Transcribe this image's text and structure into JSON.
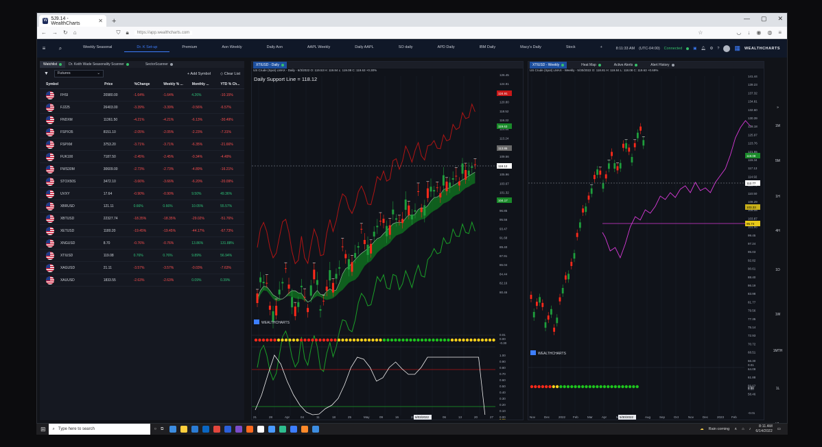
{
  "browser": {
    "tab_title": "5J9.14 - WealthCharts",
    "new_tab": "+",
    "url": "https://app.wealthcharts.com",
    "win_min": "—",
    "win_max": "▢",
    "win_close": "✕"
  },
  "app_tabs": [
    "Weekly Seasonal",
    "Dr. K Set-up",
    "Premium",
    "Aon Weekly",
    "Daily Aon",
    "AAPL Weekly",
    "Daily AAPL",
    "SO daily",
    "APD Daily",
    "IBM Daily",
    "Macy's Daily",
    "Stock"
  ],
  "header": {
    "add": "+",
    "time": "8:11:33 AM",
    "tz": "(UTC-04:00)",
    "status": "Connected",
    "logo": "WEALTHCHARTS"
  },
  "left": {
    "tabs": [
      "Watchlist",
      "Dr. Keith Wade Seasonality Scanner",
      "SectorScanner"
    ],
    "list_select": "Futures",
    "add_symbol": "Add Symbol",
    "clear_list": "Clear List",
    "columns": [
      "Symbol",
      "Price",
      "%Change",
      "Weekly % ...",
      "Monthly ...",
      "YTD % Ch..."
    ],
    "rows": [
      [
        "FHSI",
        "20980.00",
        "-1.64%",
        "-1.64%",
        "4.26%",
        "-10.15%"
      ],
      [
        "FJ225",
        "26403.00",
        "-3.39%",
        "-3.39%",
        "-0.56%",
        "-6.57%"
      ],
      [
        "FNDXM",
        "11361.50",
        "-4.21%",
        "-4.21%",
        "-6.13%",
        "-30.49%"
      ],
      [
        "FSPX35",
        "8151.10",
        "-2.05%",
        "-2.05%",
        "-2.23%",
        "-7.31%"
      ],
      [
        "FSPXM",
        "3753.20",
        "-3.71%",
        "-3.71%",
        "-6.35%",
        "-21.66%"
      ],
      [
        "FUK100",
        "7187.50",
        "-2.45%",
        "-2.45%",
        "-0.34%",
        "-4.49%"
      ],
      [
        "FWS30M",
        "30609.00",
        "-2.73%",
        "-2.73%",
        "-4.89%",
        "-16.21%"
      ],
      [
        "STOX50S",
        "3472.10",
        "-3.66%",
        "-3.66%",
        "-6.20%",
        "-20.09%"
      ],
      [
        "UVXY",
        "17.64",
        "-0.90%",
        "-0.90%",
        "9.50%",
        "49.36%"
      ],
      [
        "XBRUSD",
        "121.11",
        "0.66%",
        "0.66%",
        "10.05%",
        "55.57%"
      ],
      [
        "XBTUSD",
        "22327.74",
        "-18.35%",
        "-18.35%",
        "-29.02%",
        "-51.76%"
      ],
      [
        "XETUSD",
        "1180.20",
        "-19.45%",
        "-19.45%",
        "-44.17%",
        "-67.73%"
      ],
      [
        "XNGUSD",
        "8.70",
        "-0.76%",
        "-0.76%",
        "13.86%",
        "131.88%"
      ],
      [
        "XTIUSD",
        "119.08",
        "0.76%",
        "0.76%",
        "9.89%",
        "56.94%"
      ],
      [
        "XAGUSD",
        "21.11",
        "-3.57%",
        "-3.57%",
        "-0.03%",
        "-7.63%"
      ],
      [
        "XAUUSD",
        "1833.55",
        "-2.63%",
        "-2.63%",
        "0.09%",
        "0.39%"
      ]
    ]
  },
  "mid": {
    "tab": "XTIUSD - Daily",
    "info": "US Crude (Spot) LMAX - Daily - 6/3/2022 O: 119.53 H: 119.84 L: 119.08 C: 119.63 +0.30%",
    "annotation": "Daily Support Line = 118.12",
    "brand": "WEALTHCHARTS",
    "price_ticks": [
      "126.45",
      "124.91",
      "122.10",
      "120.80",
      "118.52",
      "116.22",
      "114.54",
      "113.24",
      "111.76",
      "109.56",
      "107.25",
      "105.96",
      "103.67",
      "101.32",
      "99.05",
      "96.85",
      "95.56",
      "93.47",
      "91.68",
      "89.40",
      "87.91",
      "86.04",
      "84.44",
      "82.16",
      "80.46"
    ],
    "price_labels": {
      "red": "124.91",
      "green1": "119.63",
      "gray": "113.86",
      "support": "118.12",
      "green2": "104.17"
    },
    "ind1_ticks": [
      "0.01",
      "0.00",
      "-0.30"
    ],
    "ind2_ticks": [
      "1.00",
      "0.90",
      "0.80",
      "0.70",
      "0.60",
      "0.50",
      "0.40",
      "0.30",
      "0.20",
      "0.10",
      "0.00"
    ],
    "ind2_label": "0.00",
    "x_ticks": [
      "21",
      "28",
      "Apr",
      "04",
      "11",
      "18",
      "25",
      "May",
      "09",
      "16",
      "23",
      "Jun",
      "06",
      "13",
      "20",
      "27"
    ],
    "x_date": "6/03/2022"
  },
  "right": {
    "tabs": [
      "XTIUSD - Weekly",
      "Heat Map",
      "Active Alerts",
      "Alert History"
    ],
    "info": "US Crude (Spot) LMAX - Weekly - 5/30/2022 O: 118.81 H: 119.84 L: 118.08 C: 119.63 +0.69%",
    "brand": "WEALTHCHARTS",
    "price_ticks": [
      "141.44",
      "139.23",
      "137.32",
      "134.81",
      "132.60",
      "130.39",
      "128.18",
      "125.97",
      "123.76",
      "121.55",
      "119.34",
      "117.13",
      "114.92",
      "112.71",
      "110.50",
      "108.29",
      "106.08",
      "103.87",
      "101.66",
      "99.45",
      "97.24",
      "95.03",
      "92.82",
      "90.61",
      "88.40",
      "86.19",
      "83.98",
      "81.77",
      "79.56",
      "77.35",
      "75.14",
      "72.93",
      "70.72",
      "68.51",
      "66.30",
      "64.09",
      "61.88",
      "59.67",
      "58.46"
    ],
    "price_labels": {
      "green": "119.08",
      "white": "112.77",
      "yellow1": "103.33",
      "yellow2": "95.74"
    },
    "ind_ticks": [
      "0.01",
      "0.00",
      "-0.01"
    ],
    "ind_label": "0.00",
    "x_ticks": [
      "Nov",
      "Dec",
      "2022",
      "Feb",
      "Mar",
      "Apr",
      "May",
      "Jul",
      "Aug",
      "Sep",
      "Oct",
      "Nov",
      "Dec",
      "2023",
      "Feb"
    ],
    "x_date": "5/30/2022"
  },
  "timeframes": [
    "»",
    "1M",
    "5M",
    "1H",
    "4H",
    "1D",
    "1W",
    "1MTH",
    "1L",
    "VL",
    "T"
  ],
  "taskbar": {
    "search": "Type here to search",
    "weather": "Rain coming",
    "time": "8:11 AM",
    "date": "6/14/2022"
  },
  "colors": {
    "up": "#1e9e3c",
    "down": "#ff2a1a",
    "accent": "#3d7eff",
    "connected": "#37c06a",
    "magenta": "#d93ad9"
  }
}
